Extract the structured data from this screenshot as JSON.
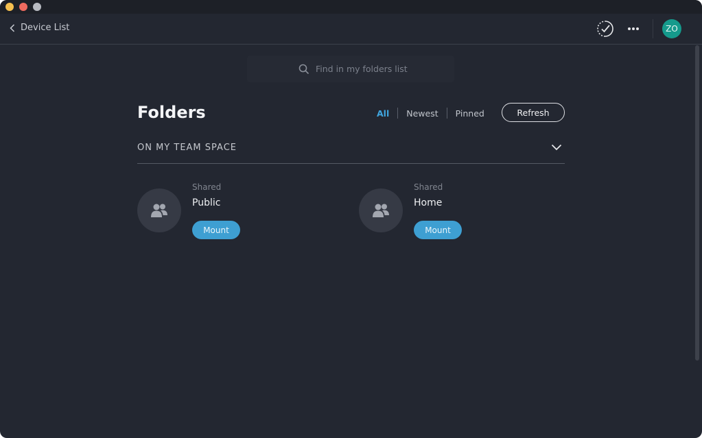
{
  "nav": {
    "back_label": "Device List"
  },
  "user": {
    "initials": "ZO"
  },
  "search": {
    "placeholder": "Find in my folders list"
  },
  "page": {
    "title": "Folders"
  },
  "filters": {
    "all": "All",
    "newest": "Newest",
    "pinned": "Pinned",
    "active": "All"
  },
  "refresh_label": "Refresh",
  "section": {
    "title": "ON MY TEAM SPACE"
  },
  "folders": [
    {
      "type": "Shared",
      "name": "Public",
      "action": "Mount"
    },
    {
      "type": "Shared",
      "name": "Home",
      "action": "Mount"
    }
  ],
  "colors": {
    "background": "#232731",
    "accent": "#3e9fd2",
    "avatar": "#159a8c",
    "active_filter": "#40a6df"
  },
  "icons": [
    "chevron-left-icon",
    "sync-check-icon",
    "more-icon",
    "search-icon",
    "chevron-down-icon",
    "group-icon"
  ]
}
